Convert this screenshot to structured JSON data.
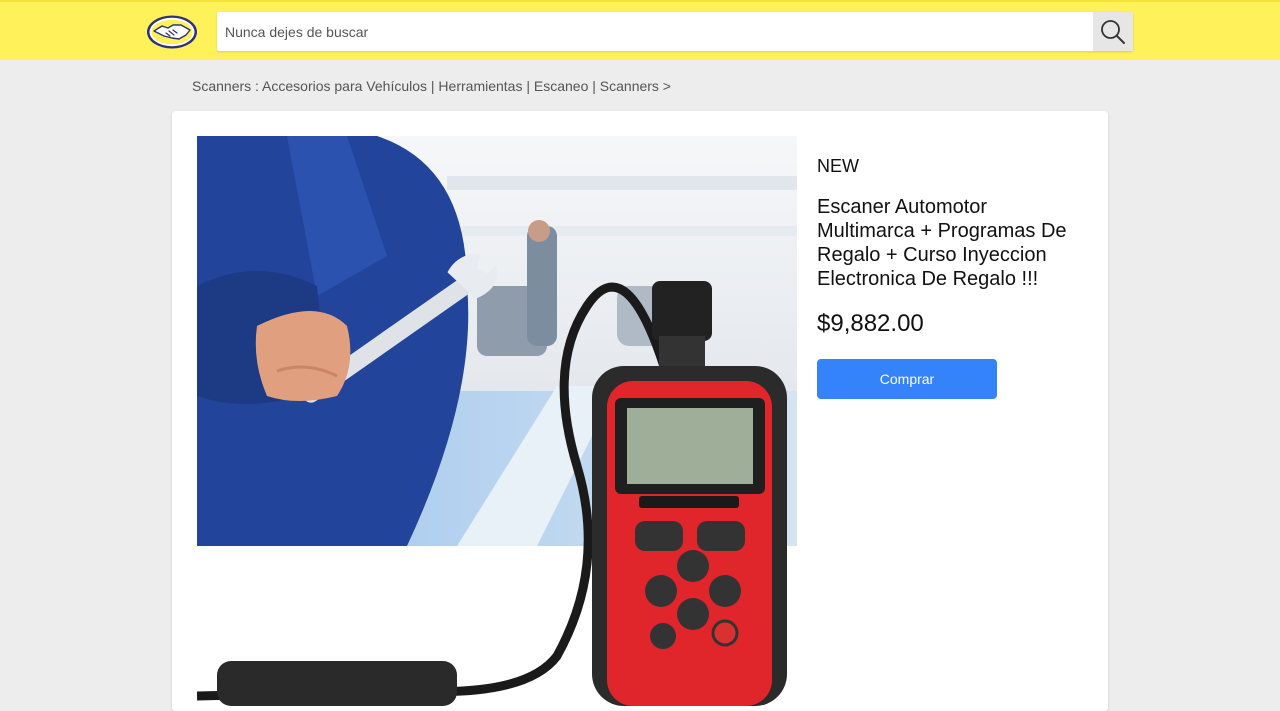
{
  "header": {
    "search": {
      "placeholder": "Nunca dejes de buscar",
      "value": ""
    },
    "brand_color": "#fff159"
  },
  "breadcrumb": {
    "text": "Scanners : Accesorios para Vehículos | Herramientas | Escaneo | Scanners >"
  },
  "product": {
    "condition": "NEW",
    "title": "Escaner Automotor Multimarca + Programas De Regalo + Curso Inyeccion Electronica De Regalo !!!",
    "price": "$9,882.00",
    "buy_label": "Comprar",
    "buy_color": "#3483fa",
    "image": "obd2-scanner-photo"
  }
}
